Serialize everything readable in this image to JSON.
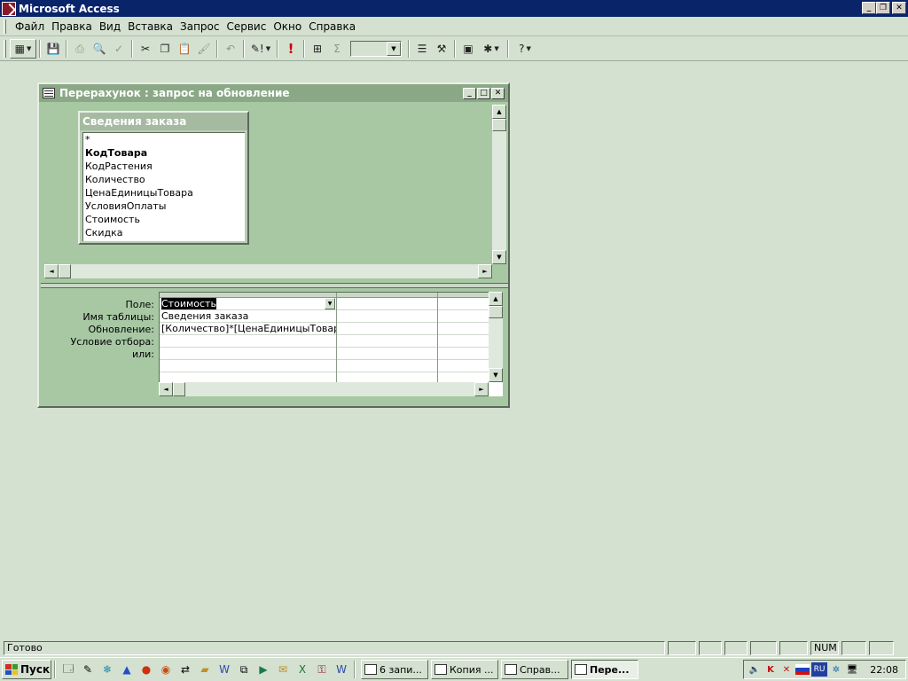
{
  "app": {
    "title": "Microsoft Access",
    "window_buttons": [
      "_",
      "❐",
      "✕"
    ]
  },
  "menu": [
    {
      "label": "Файл",
      "hot": "Ф"
    },
    {
      "label": "Правка",
      "hot": "П"
    },
    {
      "label": "Вид",
      "hot": "В"
    },
    {
      "label": "Вставка",
      "hot": "с"
    },
    {
      "label": "Запрос",
      "hot": "З"
    },
    {
      "label": "Сервис",
      "hot": "С"
    },
    {
      "label": "Окно",
      "hot": "О"
    },
    {
      "label": "Справка",
      "hot": "С"
    }
  ],
  "toolbar": {
    "icons": [
      "view-icon",
      "save-icon",
      "print-icon",
      "print-preview-icon",
      "spelling-icon",
      "cut-icon",
      "copy-icon",
      "paste-icon",
      "format-painter-icon",
      "undo-icon",
      "query-type-icon",
      "run-icon",
      "show-table-icon",
      "totals-icon",
      "properties-icon",
      "builder-icon",
      "database-window-icon",
      "new-object-icon",
      "help-icon"
    ],
    "top_values": ""
  },
  "query_window": {
    "title": "Перерахунок : запрос на обновление",
    "table": {
      "name": "Сведения заказа",
      "fields": [
        "*",
        "КодТовара",
        "КодРастения",
        "Количество",
        "ЦенаЕдиницыТовара",
        "УсловияОплаты",
        "Стоимость",
        "Скидка"
      ],
      "key_field": "КодТовара"
    },
    "grid": {
      "row_labels": [
        "Поле:",
        "Имя таблицы:",
        "Обновление:",
        "Условие отбора:",
        "или:"
      ],
      "columns": [
        {
          "field": "Стоимость",
          "table": "Сведения заказа",
          "update": "[Количество]*[ЦенаЕдиницыТовара]",
          "criteria": "",
          "or": ""
        },
        {
          "field": "",
          "table": "",
          "update": "",
          "criteria": "",
          "or": ""
        },
        {
          "field": "",
          "table": "",
          "update": "",
          "criteria": "",
          "or": ""
        }
      ]
    }
  },
  "status": {
    "text": "Готово",
    "num": "NUM"
  },
  "taskbar": {
    "start": "Пуск",
    "tasks": [
      {
        "label": "6 запи...",
        "active": false
      },
      {
        "label": "Копия ...",
        "active": false
      },
      {
        "label": "Справ...",
        "active": false
      },
      {
        "label": "Пере...",
        "active": true
      }
    ],
    "lang": "RU",
    "clock": "22:08"
  },
  "colors": {
    "title_active": "#0a246a",
    "desktop": "#d4e0d0",
    "query_bg": "#a8c8a4",
    "run_icon": "#cc0000"
  }
}
